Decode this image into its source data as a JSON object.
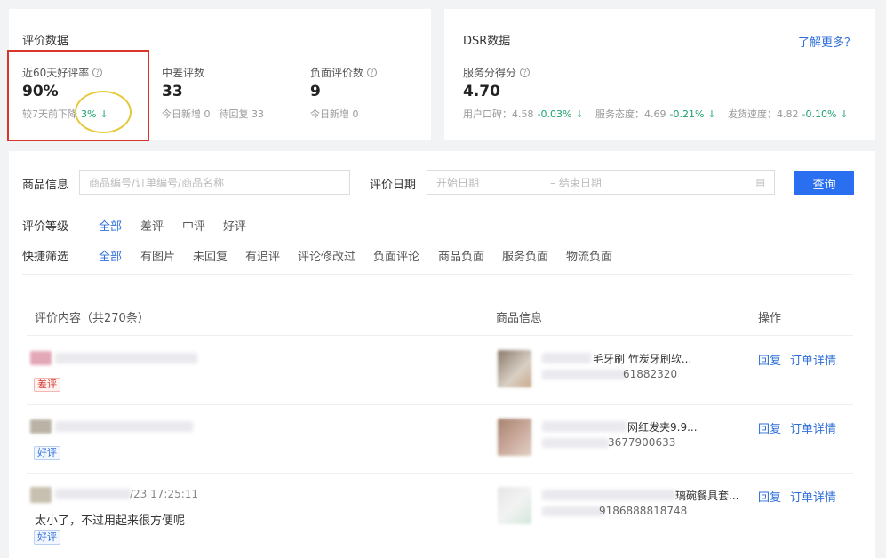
{
  "eval_card": {
    "title": "评价数据",
    "good_rate": {
      "label": "近60天好评率",
      "value": "90%",
      "sub_prefix": "较7天前下降",
      "sub_change": "3%"
    },
    "mid_bad": {
      "label": "中差评数",
      "value": "33",
      "today_new": "今日新增 0",
      "pending": "待回复 33"
    },
    "negative": {
      "label": "负面评价数",
      "value": "9",
      "today_new": "今日新增 0"
    }
  },
  "dsr_card": {
    "title": "DSR数据",
    "learn_more": "了解更多？",
    "score_label": "服务分得分",
    "score_value": "4.70",
    "items": [
      {
        "label": "用户口碑：4.58",
        "change": "-0.03%"
      },
      {
        "label": "服务态度：4.69",
        "change": "-0.21%"
      },
      {
        "label": "发货速度：4.82",
        "change": "-0.10%"
      }
    ]
  },
  "filters": {
    "product_label": "商品信息",
    "product_placeholder": "商品编号/订单编号/商品名称",
    "date_label": "评价日期",
    "start_placeholder": "开始日期",
    "end_placeholder": "– 结束日期",
    "query": "查询",
    "level_label": "评价等级",
    "levels": [
      "全部",
      "差评",
      "中评",
      "好评"
    ],
    "quick_label": "快捷筛选",
    "quick": [
      "全部",
      "有图片",
      "未回复",
      "有追评",
      "评论修改过",
      "负面评论",
      "商品负面",
      "服务负面",
      "物流负面"
    ]
  },
  "table": {
    "headers": [
      "评价内容（共270条）",
      "商品信息",
      "操作"
    ],
    "rows": [
      {
        "tag": "差评",
        "tag_type": "bad",
        "product_name": "毛牙刷 竹炭牙刷软...",
        "product_id": "61882320",
        "reply": "回复",
        "detail": "订单详情"
      },
      {
        "tag": "好评",
        "tag_type": "good",
        "product_name": "网红发夹9.9...",
        "product_id": "3677900633",
        "reply": "回复",
        "detail": "订单详情"
      },
      {
        "time": "/23 17:25:11",
        "text": "太小了，不过用起来很方便呢",
        "tag": "好评",
        "tag_type": "good",
        "product_name": "璃碗餐具套...",
        "product_id": "9186888818748",
        "reply": "回复",
        "detail": "订单详情"
      }
    ]
  },
  "colors": {
    "accent": "#2a6ff0",
    "down": "#1aa36b",
    "bad": "#d43a30",
    "highlight_red": "#d8362b",
    "highlight_yellow": "#e6c93a"
  }
}
